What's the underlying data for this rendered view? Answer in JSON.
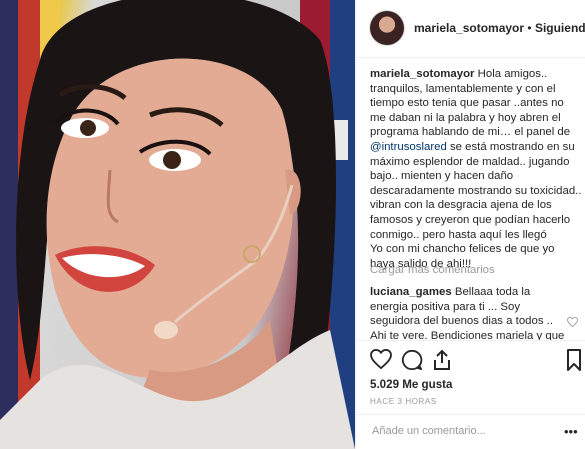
{
  "header": {
    "username": "mariela_sotomayor",
    "separator": " • ",
    "follow_status": "Siguiendo"
  },
  "caption": {
    "username": "mariela_sotomayor",
    "text_before_mention": " Hola amigos.. tranquilos, lamentablemente y con el tiempo esto tenia que pasar ..antes no me daban ni la palabra y hoy abren el programa hablando de mi… el panel de ",
    "mention": "@intrusoslared",
    "text_after_mention": " se está mostrando en su máximo esplendor de maldad.. jugando bajo.. mienten y hacen daño descaradamente mostrando su toxicidad.. vibran con la desgracia ajena de los famosos y creyeron que podían hacerlo conmigo.. pero hasta aquí les llegó",
    "text_line2": "Yo con mi chancho felices de que yo haya salido de ahi!!!"
  },
  "load_more": "Cargar más comentarios",
  "comment": {
    "username": "luciana_games",
    "text": " Bellaaa toda la energia positiva para ti ... Soy seguidora del buenos dias a todos .. Ahi te vere. Bendiciones mariela y que no te afecten los comentarios de gente sin"
  },
  "actions": {
    "like_icon": "heart-icon",
    "comment_icon": "comment-icon",
    "share_icon": "share-icon",
    "save_icon": "bookmark-icon"
  },
  "likes": "5.029 Me gusta",
  "timestamp": "HACE 3 HORAS",
  "add_comment": {
    "placeholder": "Añade un comentario...",
    "more_icon": "more-options-icon"
  }
}
